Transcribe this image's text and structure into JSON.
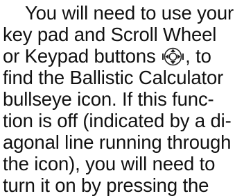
{
  "paragraph": {
    "line1": "You will need to use your",
    "line2": "key pad and Scroll Wheel",
    "line3_before": "or Keypad buttons",
    "line3_after": ", to",
    "line4": "find the Ballistic Calculator",
    "line5": "bullseye icon. If this func-",
    "line6": "tion is off (indicated by a di-",
    "line7": "agonal line running through",
    "line8": "the icon), you will need to",
    "line9": "turn it on by pressing the"
  },
  "icons": {
    "keypad": "keypad-buttons-icon"
  },
  "colors": {
    "text": "#111111",
    "background": "#ffffff"
  }
}
